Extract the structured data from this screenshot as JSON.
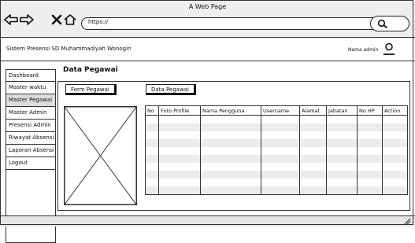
{
  "browser": {
    "window_title": "A Web Page",
    "address": "https://"
  },
  "app": {
    "title": "Sistem Presensi SD Muhammadiyah Wonogiri",
    "admin_label": "Nama admin"
  },
  "sidebar": {
    "items": [
      {
        "label": "Dashboard"
      },
      {
        "label": "Master waktu"
      },
      {
        "label": "Master Pegawai"
      },
      {
        "label": "Master Admin"
      },
      {
        "label": "Presensi Admin"
      },
      {
        "label": "Riwayat Absensi"
      },
      {
        "label": "Laporan Absensi"
      },
      {
        "label": "Logout"
      }
    ]
  },
  "main": {
    "title": "Data Pegawai",
    "form_button": "Form Pegawai",
    "data_button": "Data Pegawai"
  },
  "table": {
    "columns": [
      "No",
      "Foto Profile",
      "Nama Pengguna",
      "Username",
      "Alamat",
      "Jabatan",
      "No HP",
      "Action"
    ]
  }
}
